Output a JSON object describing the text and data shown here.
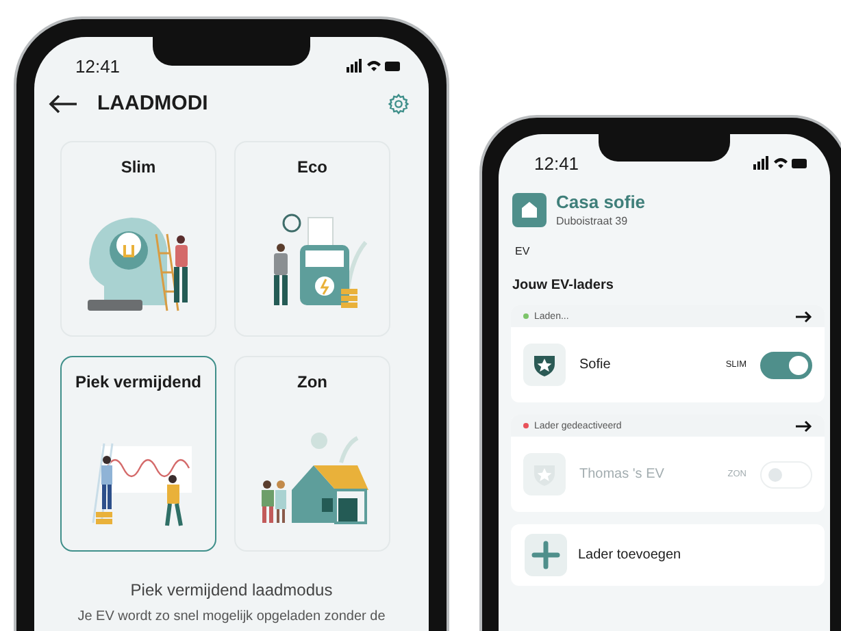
{
  "left_phone": {
    "status_bar": {
      "time": "12:41"
    },
    "header": {
      "title": "LAADMODI"
    },
    "modes": [
      {
        "label": "Slim",
        "kind": "brain",
        "selected": false
      },
      {
        "label": "Eco",
        "kind": "meter",
        "selected": false
      },
      {
        "label": "Piek vermijdend",
        "kind": "peak",
        "selected": true
      },
      {
        "label": "Zon",
        "kind": "house",
        "selected": false
      }
    ],
    "description": {
      "title": "Piek vermijdend laadmodus",
      "text": "Je EV wordt zo snel mogelijk opgeladen zonder de"
    }
  },
  "right_phone": {
    "status_bar": {
      "time": "12:41"
    },
    "location": {
      "name": "Casa sofie",
      "address": "Duboistraat 39"
    },
    "section_label": "EV",
    "section_title": "Jouw EV-laders",
    "chargers": [
      {
        "status": "Laden...",
        "color": "#7cc46a",
        "name": "Sofie",
        "mode": "SLIM",
        "on": true,
        "disabled": false
      },
      {
        "status": "Lader gedeactiveerd",
        "color": "#e8525a",
        "name": "Thomas 's EV",
        "mode": "ZON",
        "on": false,
        "disabled": true
      }
    ],
    "add_button": {
      "label": "Lader toevoegen"
    }
  }
}
